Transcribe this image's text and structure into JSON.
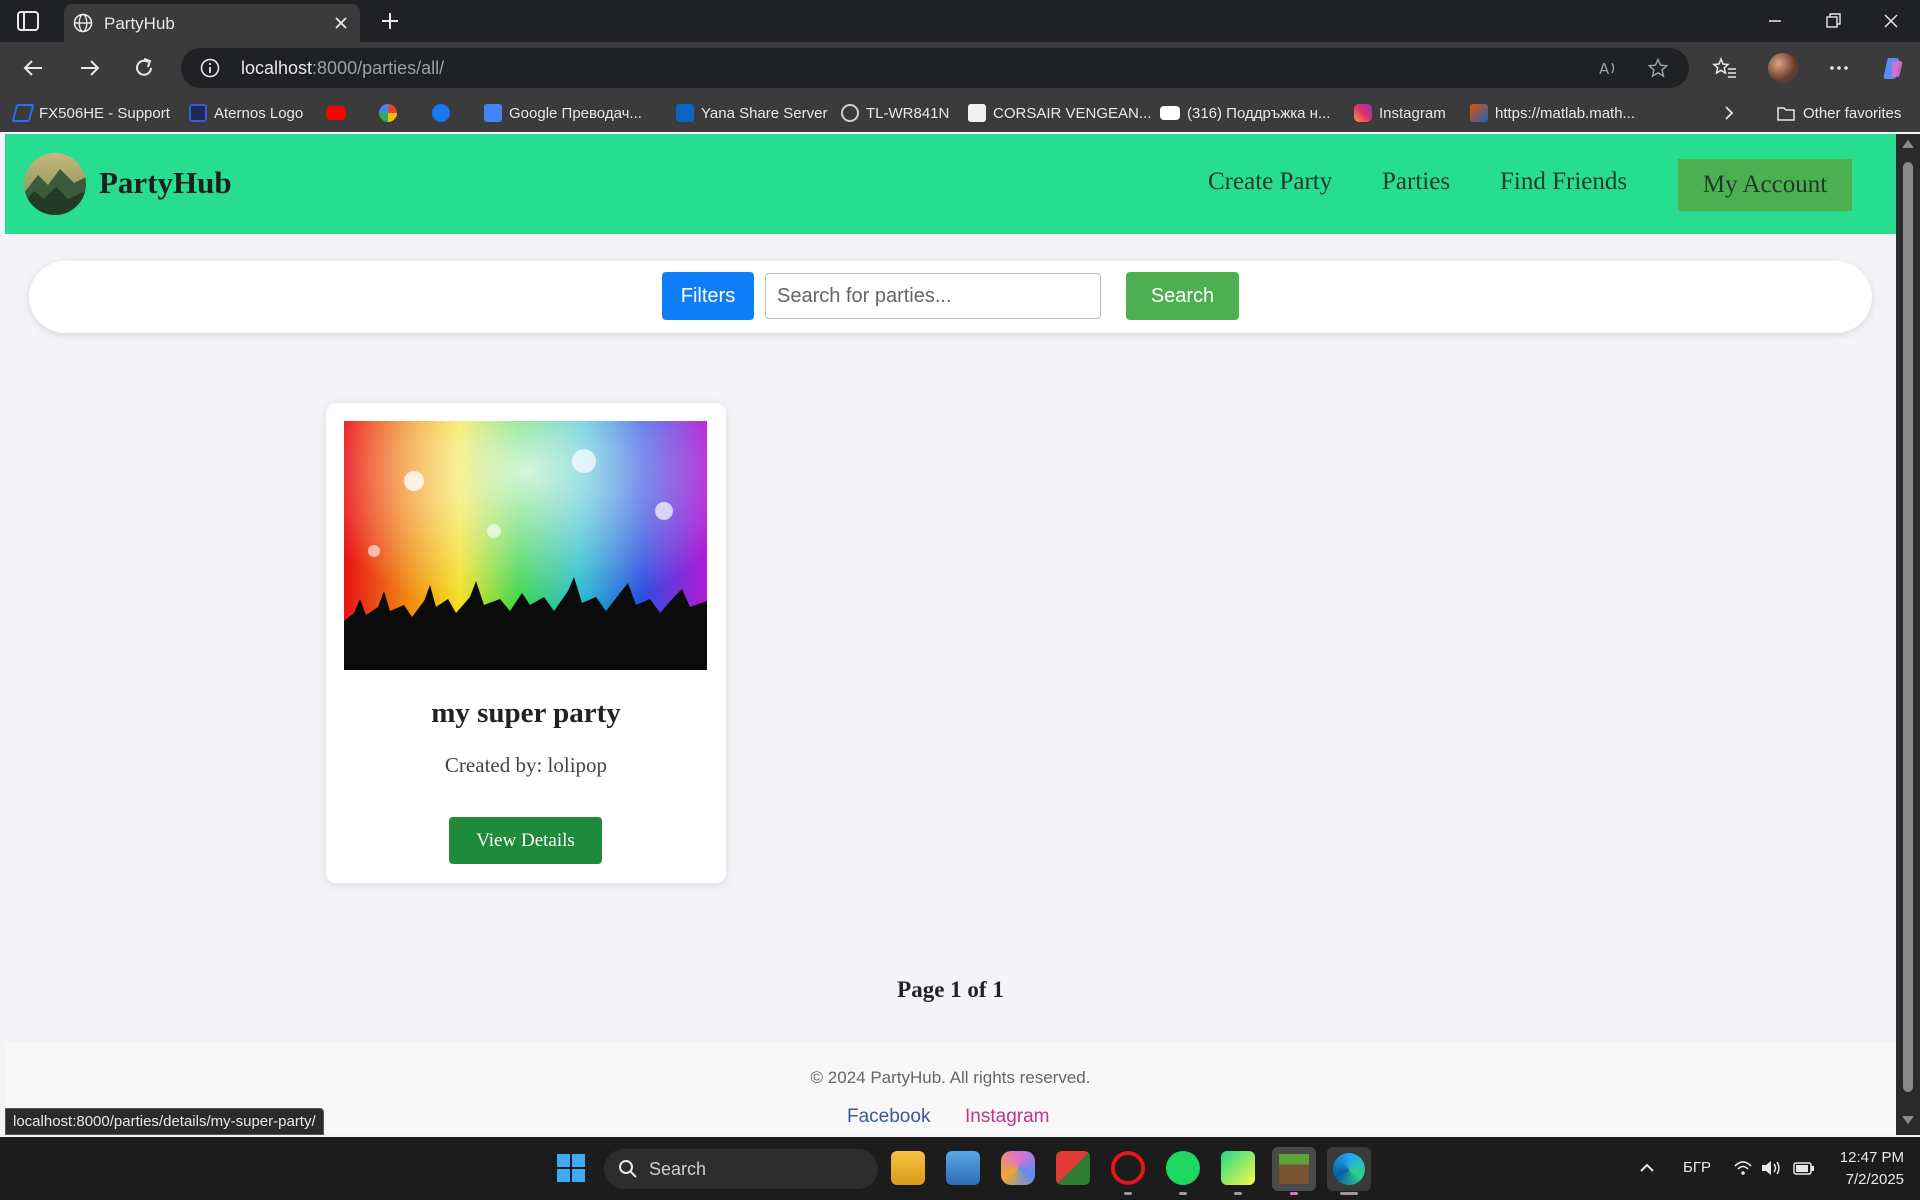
{
  "browser": {
    "tab_title": "PartyHub",
    "url_host": "localhost",
    "url_rest": ":8000/parties/all/",
    "bookmarks": [
      {
        "label": "FX506HE - Support",
        "color": "#2f6df6"
      },
      {
        "label": "Aternos Logo",
        "color": "#3b5bdb"
      },
      {
        "label": "",
        "color": "#ff0000"
      },
      {
        "label": "",
        "color": "#ffffff"
      },
      {
        "label": "",
        "color": "#1877f2"
      },
      {
        "label": "Google Преводач...",
        "color": "#4285f4"
      },
      {
        "label": "Yana Share Server",
        "color": "#0a66c2"
      },
      {
        "label": "TL-WR841N",
        "color": "#9aa0a6"
      },
      {
        "label": "CORSAIR VENGEAN...",
        "color": "#f1f1f1"
      },
      {
        "label": "(316) Поддръжка н...",
        "color": "#ffffff"
      },
      {
        "label": "Instagram",
        "color": "#e1306c"
      },
      {
        "label": "https://matlab.math...",
        "color": "#e65100"
      }
    ],
    "other_favorites": "Other favorites",
    "status_url": "localhost:8000/parties/details/my-super-party/"
  },
  "site": {
    "brand": "PartyHub",
    "nav": {
      "create_party": "Create Party",
      "parties": "Parties",
      "find_friends": "Find Friends",
      "my_account": "My Account"
    },
    "colors": {
      "header": "#27de90",
      "primary": "#0d7ef5",
      "success": "#4caf50"
    }
  },
  "search": {
    "filters_label": "Filters",
    "placeholder": "Search for parties...",
    "value": "",
    "search_label": "Search"
  },
  "parties": [
    {
      "title": "my super party",
      "creator": "Created by: lolipop",
      "button": "View Details"
    }
  ],
  "pagination": {
    "text": "Page 1 of 1"
  },
  "footer": {
    "copyright": "© 2024 PartyHub. All rights reserved.",
    "facebook": "Facebook",
    "instagram": "Instagram"
  },
  "taskbar": {
    "search_label": "Search",
    "lang": "БГР",
    "time": "12:47 PM",
    "date": "7/2/2025"
  }
}
